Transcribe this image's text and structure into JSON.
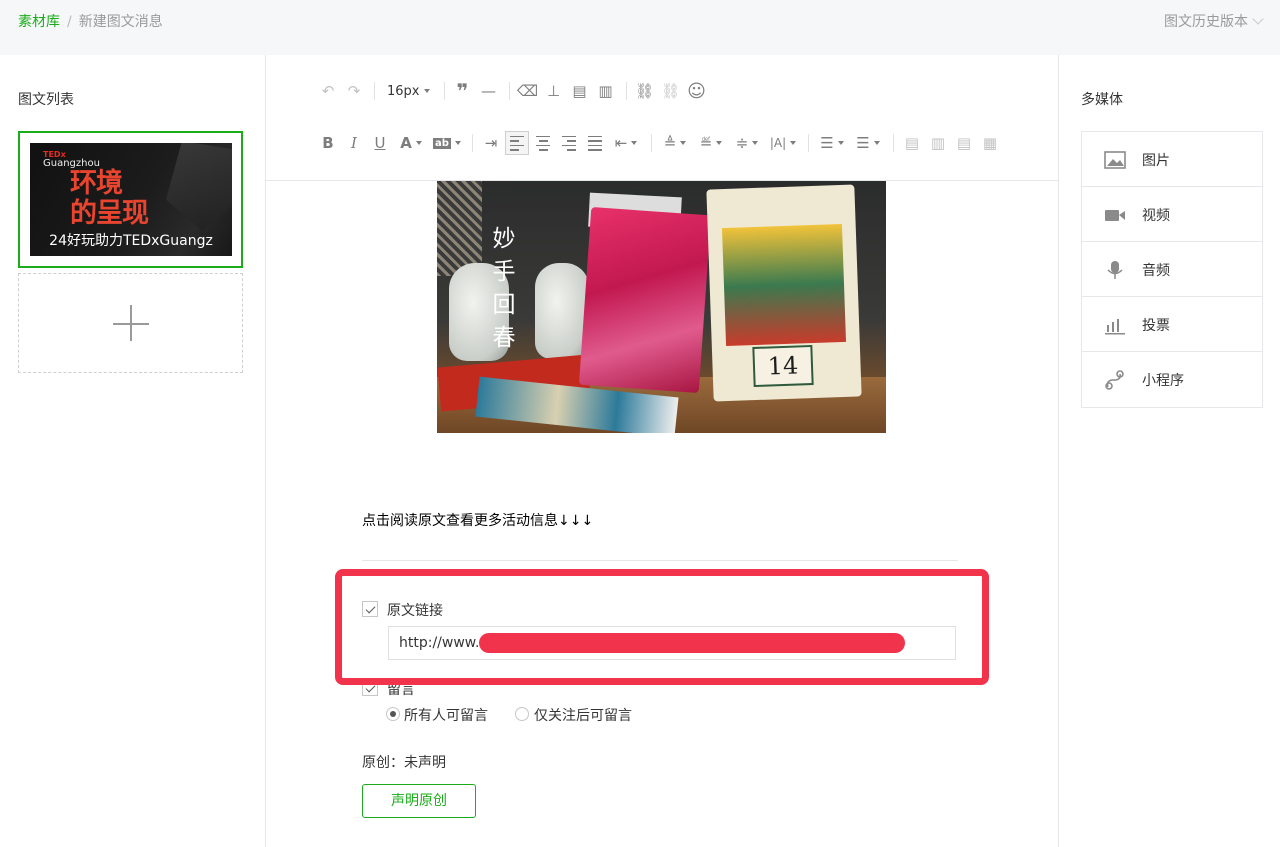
{
  "breadcrumb": {
    "root": "素材库",
    "separator": "/",
    "current": "新建图文消息"
  },
  "history": {
    "label": "图文历史版本"
  },
  "left": {
    "title": "图文列表",
    "article": {
      "cover_brand": "TEDx",
      "cover_city": "Guangzhou",
      "cover_headline": "环境的呈现",
      "caption": "24好玩助力TEDxGuangz"
    }
  },
  "toolbar": {
    "font_size": "16px",
    "row1_icons": [
      "undo-icon",
      "redo-icon",
      "font-size-select",
      "blockquote-icon",
      "horizontal-rule-icon",
      "clear-format-icon",
      "format-brush-icon",
      "insert-template-icon",
      "paste-text-icon",
      "link-icon",
      "unlink-icon",
      "emoji-icon"
    ],
    "row2_icons": [
      "bold-icon",
      "italic-icon",
      "underline-icon",
      "font-color-icon",
      "background-color-icon",
      "indent-icon",
      "align-left-icon",
      "align-center-icon",
      "align-right-icon",
      "align-justify-icon",
      "first-line-indent-icon",
      "spacing-before-icon",
      "spacing-after-icon",
      "line-height-icon",
      "letter-spacing-icon",
      "ordered-list-icon",
      "unordered-list-icon",
      "image-left-icon",
      "image-inline-icon",
      "image-right-icon",
      "image-center-icon"
    ]
  },
  "content": {
    "hero_vertical_text": "妙手回春",
    "hero_calendar_number": "14",
    "read_more_text": "点击阅读原文查看更多活动信息↓↓↓"
  },
  "options": {
    "original_link": {
      "label": "原文链接",
      "checked": true,
      "value": "http://www."
    },
    "comment": {
      "label": "留言",
      "checked": true
    },
    "comment_radio": [
      {
        "label": "所有人可留言",
        "selected": true
      },
      {
        "label": "仅关注后可留言",
        "selected": false
      }
    ],
    "originality": {
      "label": "原创：",
      "status": "未声明"
    },
    "declare_button": "声明原创"
  },
  "right": {
    "title": "多媒体",
    "items": [
      {
        "label": "图片",
        "icon": "image-icon"
      },
      {
        "label": "视频",
        "icon": "video-icon"
      },
      {
        "label": "音频",
        "icon": "audio-icon"
      },
      {
        "label": "投票",
        "icon": "vote-icon"
      },
      {
        "label": "小程序",
        "icon": "mini-program-icon"
      }
    ]
  },
  "colors": {
    "accent": "#1aad19",
    "highlight": "#f1334b"
  }
}
